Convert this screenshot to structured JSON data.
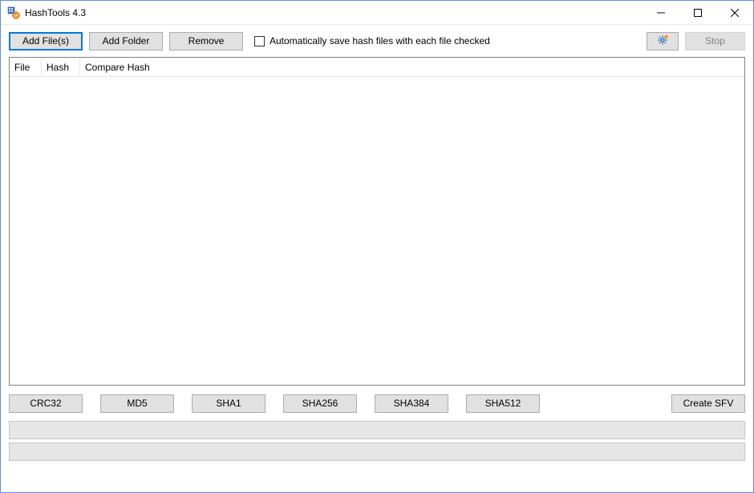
{
  "window": {
    "title": "HashTools 4.3"
  },
  "toolbar": {
    "add_files": "Add File(s)",
    "add_folder": "Add Folder",
    "remove": "Remove",
    "auto_save_label": "Automatically save hash files with each file checked",
    "stop": "Stop"
  },
  "table": {
    "headers": {
      "file": "File",
      "hash": "Hash",
      "compare": "Compare Hash"
    }
  },
  "hash_buttons": {
    "crc32": "CRC32",
    "md5": "MD5",
    "sha1": "SHA1",
    "sha256": "SHA256",
    "sha384": "SHA384",
    "sha512": "SHA512",
    "create_sfv": "Create SFV"
  }
}
